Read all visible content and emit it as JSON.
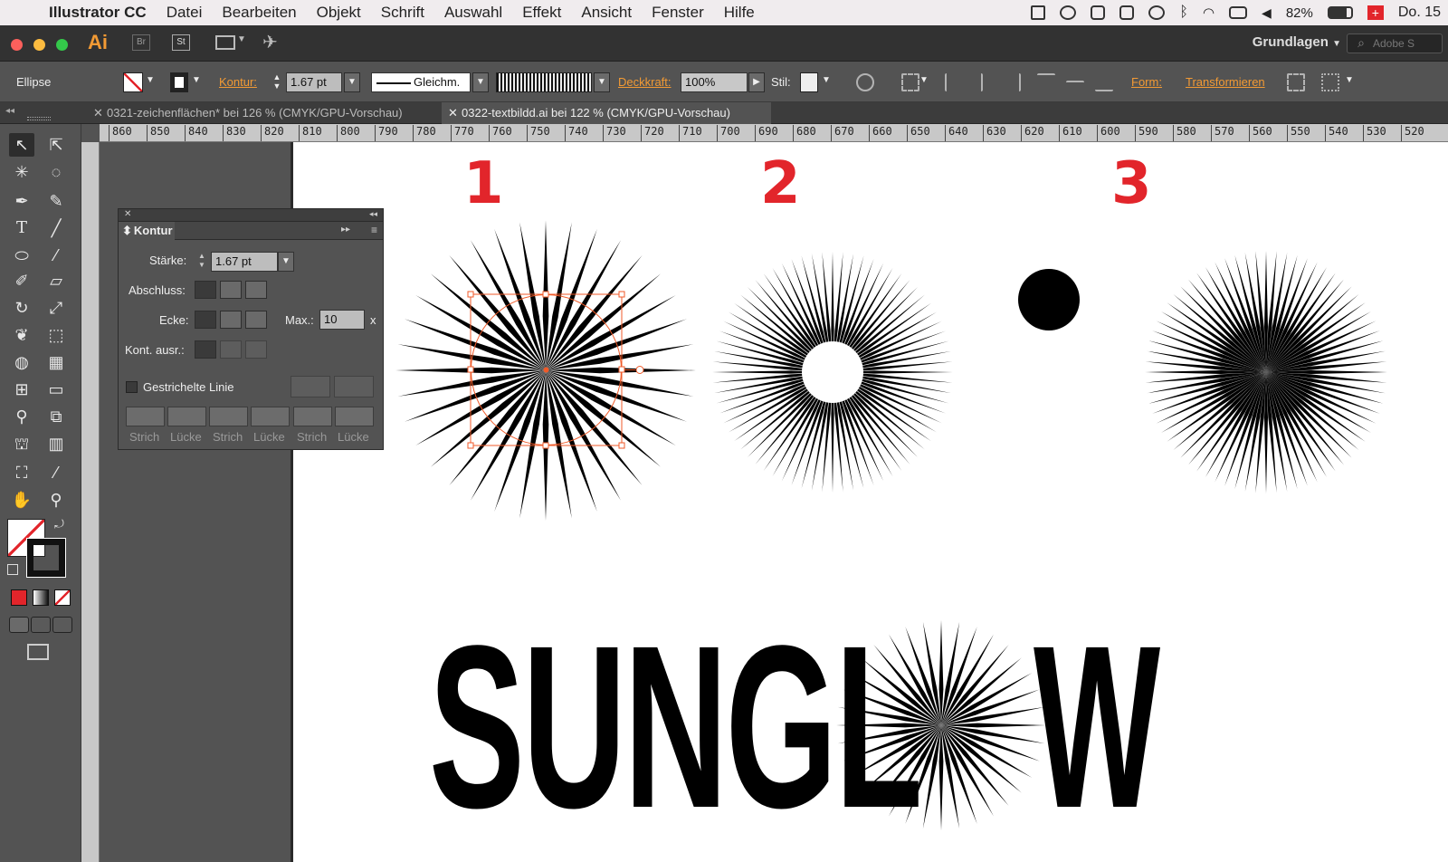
{
  "menubar": {
    "app_name": "Illustrator CC",
    "items": [
      "Datei",
      "Bearbeiten",
      "Objekt",
      "Schrift",
      "Auswahl",
      "Effekt",
      "Ansicht",
      "Fenster",
      "Hilfe"
    ],
    "battery": "82%",
    "clock": "Do. 15"
  },
  "appbar": {
    "logo": "Ai",
    "bridge": "Br",
    "stock": "St",
    "workspace": "Grundlagen",
    "search_placeholder": "Adobe S"
  },
  "control": {
    "selection_type": "Ellipse",
    "kontur_label": "Kontur:",
    "stroke_weight": "1.67 pt",
    "stroke_profile": "Gleichm.",
    "opacity_label": "Deckkraft:",
    "opacity": "100%",
    "style_label": "Stil:",
    "form_label": "Form:",
    "transform_label": "Transformieren"
  },
  "tabs": [
    {
      "label": "0321-zeichenflächen* bei 126 % (CMYK/GPU-Vorschau)",
      "active": false
    },
    {
      "label": "0322-textbildd.ai bei 122 % (CMYK/GPU-Vorschau)",
      "active": true
    }
  ],
  "ruler": {
    "labels": [
      "860",
      "850",
      "840",
      "830",
      "820",
      "810",
      "800",
      "790",
      "780",
      "770",
      "760",
      "750",
      "740",
      "730",
      "720",
      "710",
      "700",
      "690",
      "680",
      "670",
      "660",
      "650",
      "640",
      "630",
      "620",
      "610",
      "600",
      "590",
      "580",
      "570",
      "560",
      "550",
      "540",
      "530",
      "520"
    ]
  },
  "panel": {
    "title": "Kontur",
    "staerke_label": "Stärke:",
    "staerke_value": "1.67 pt",
    "abschluss_label": "Abschluss:",
    "ecke_label": "Ecke:",
    "max_label": "Max.:",
    "max_value": "10",
    "max_unit": "x",
    "kont_ausr_label": "Kont. ausr.:",
    "dashed_label": "Gestrichelte Linie",
    "dash_labels": [
      "Strich",
      "Lücke",
      "Strich",
      "Lücke",
      "Strich",
      "Lücke"
    ]
  },
  "artwork": {
    "numbers": [
      "1",
      "2",
      "3"
    ],
    "wordmark_left": "SUNGL",
    "wordmark_right": "W"
  },
  "colors": {
    "accent_red": "#e2252b",
    "selection": "#f05a28",
    "orange_link": "#f29a34"
  }
}
